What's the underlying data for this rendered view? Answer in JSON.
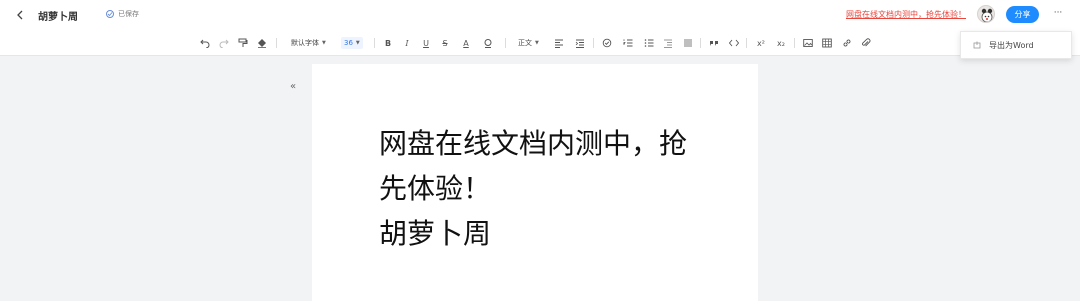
{
  "header": {
    "title": "胡萝卜周",
    "saved_status": "已保存",
    "promo_text": "网盘在线文档内测中，抢先体验！",
    "share_label": "分享",
    "more_label": "···"
  },
  "toolbar": {
    "font_family": "默认字体",
    "font_size": "36",
    "paragraph_style": "正文",
    "bold_label": "B",
    "italic_label": "I",
    "underline_label": "U",
    "strike_label": "S",
    "font_color_label": "A",
    "superscript_label": "x²",
    "subscript_label": "x₂"
  },
  "dropdown": {
    "export_word_label": "导出为Word"
  },
  "document": {
    "line1": "网盘在线文档内测中，抢",
    "line2": "先体验！",
    "line3": "胡萝卜周"
  },
  "colors": {
    "accent": "#1e8cff",
    "promo": "#e8453c",
    "background": "#f2f3f5"
  }
}
